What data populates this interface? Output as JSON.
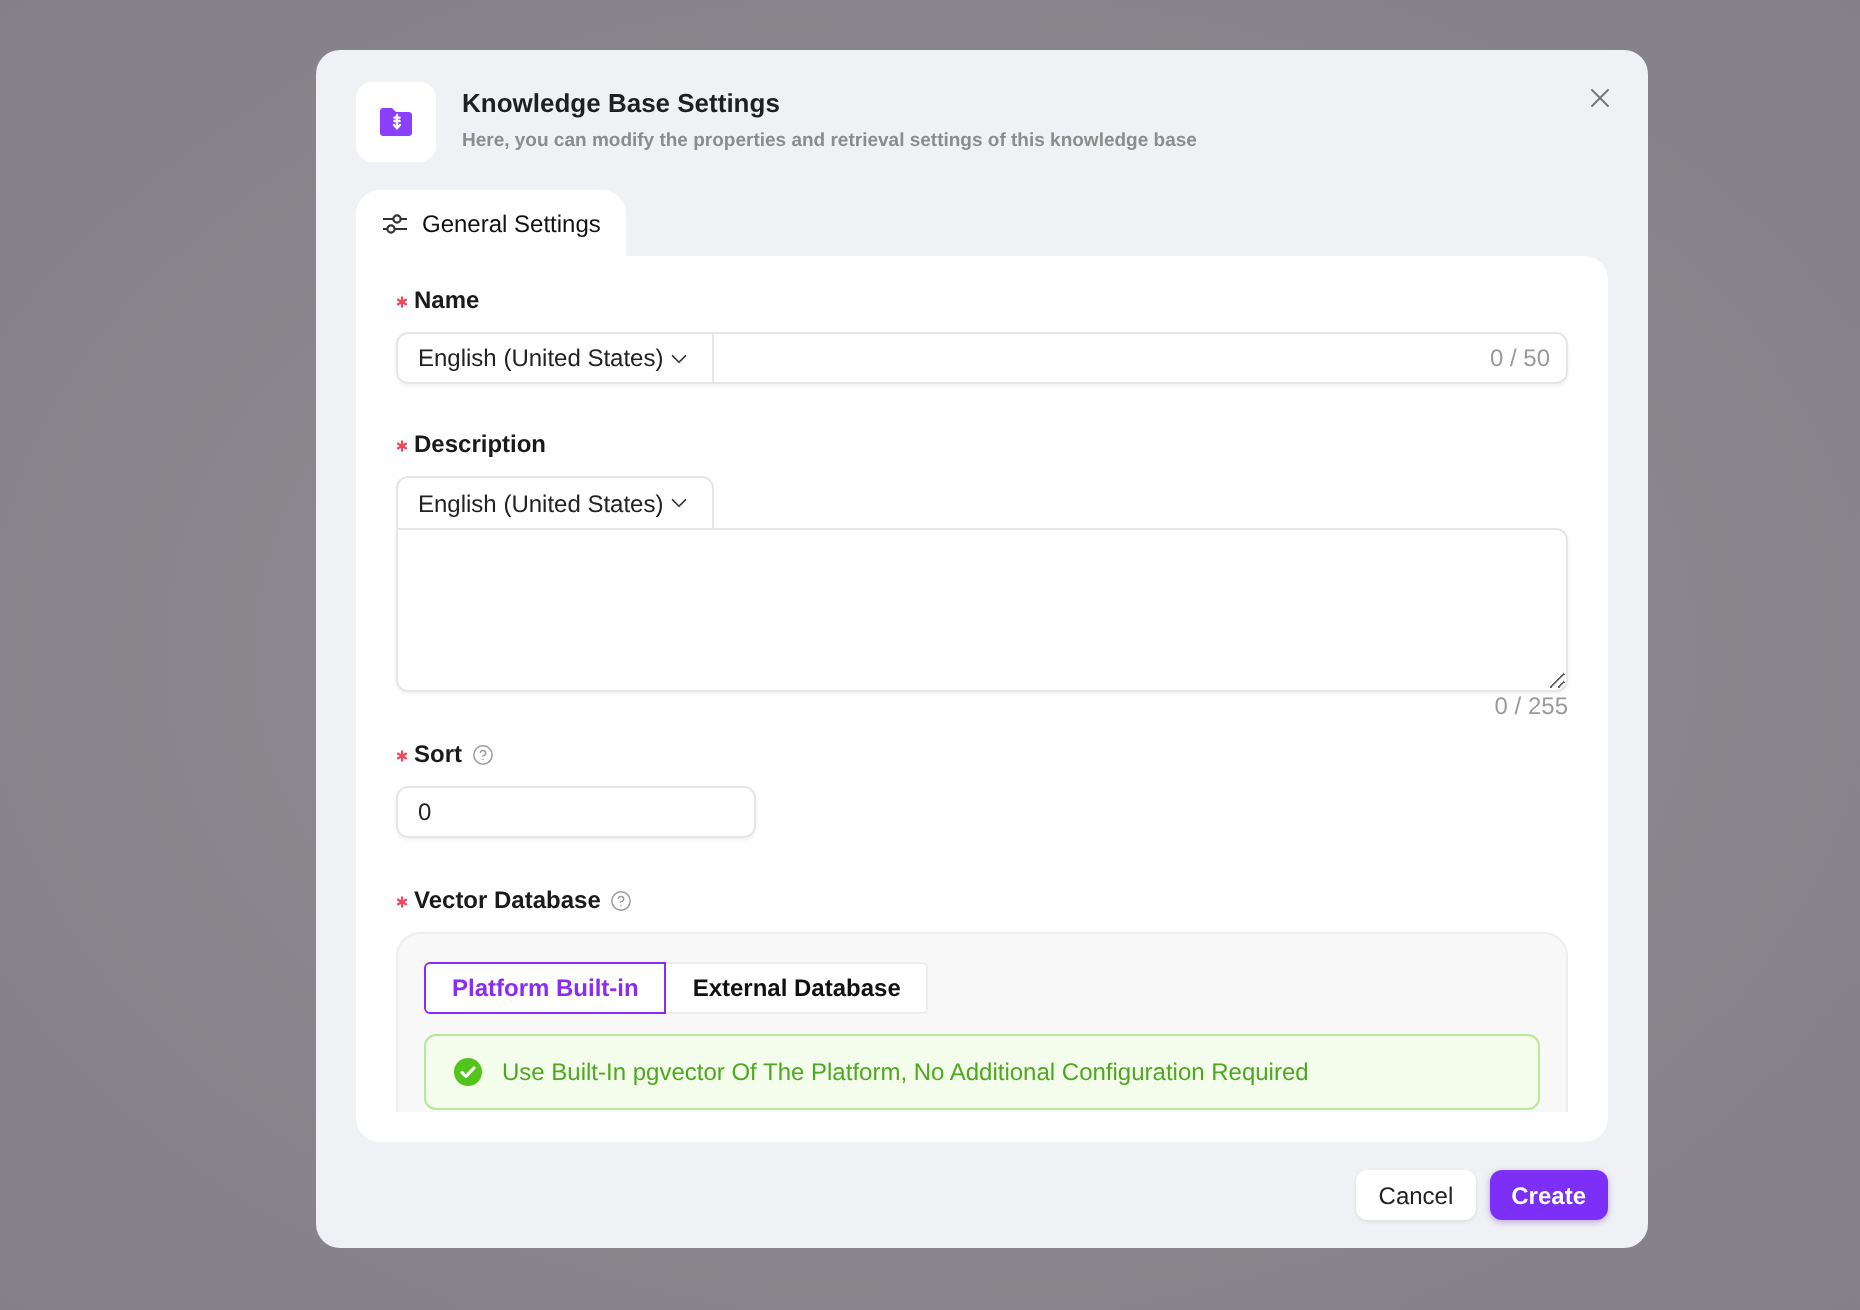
{
  "dialog": {
    "title": "Knowledge Base Settings",
    "subtitle": "Here, you can modify the properties and retrieval settings of this knowledge base"
  },
  "tabs": [
    {
      "label": "General Settings",
      "selected": true
    }
  ],
  "fields": [
    {
      "kind": "localized_input",
      "label": "Name",
      "required": true,
      "language": "English (United States)",
      "counter": "0 / 50"
    },
    {
      "kind": "localized_textarea",
      "label": "Description",
      "required": true,
      "language": "English (United States)",
      "counter": "0 / 255"
    },
    {
      "kind": "number",
      "label": "Sort",
      "required": true,
      "help": true,
      "value": "0"
    },
    {
      "kind": "segmented",
      "label": "Vector Database",
      "required": true,
      "help": true,
      "options": [
        {
          "label": "Platform Built-in",
          "selected": true
        },
        {
          "label": "External Database",
          "selected": false
        }
      ],
      "alert": {
        "kind": "success",
        "text": "Use Built-In pgvector Of The Platform, No Additional Configuration Required"
      }
    }
  ],
  "buttons": [
    {
      "label": "Cancel",
      "kind": "secondary"
    },
    {
      "label": "Create",
      "kind": "primary"
    }
  ]
}
